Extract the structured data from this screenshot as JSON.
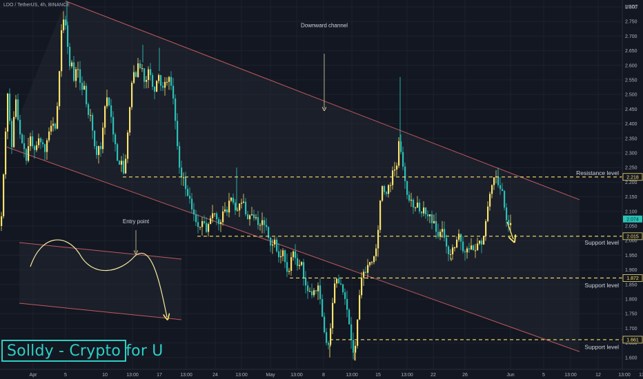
{
  "header": {
    "symbol_line": "LDO / TetherUS, 4h, BINANCE"
  },
  "watermark": {
    "text": "Solldy - Crypto for U"
  },
  "colors": {
    "background": "#131722",
    "up_candle": "#fbe36c",
    "down_candle": "#2ac1b6",
    "channel_line": "#c15a5e",
    "level_line": "#fbe36c",
    "annotation_line": "#e8e2a0"
  },
  "chart_data": {
    "type": "candlestick",
    "title": "",
    "ylabel": "USDT",
    "xlabel": "",
    "ylim": [
      1.58,
      2.83
    ],
    "y_ticks": [
      "1.600",
      "1.650",
      "1.700",
      "1.750",
      "1.800",
      "1.850",
      "1.900",
      "1.950",
      "2.000",
      "2.050",
      "2.100",
      "2.150",
      "2.200",
      "2.250",
      "2.300",
      "2.350",
      "2.400",
      "2.450",
      "2.500",
      "2.550",
      "2.600",
      "2.650",
      "2.700",
      "2.750",
      "2.800"
    ],
    "x_ticks": [
      "Apr",
      "5",
      "10",
      "13:00",
      "17",
      "13:00",
      "24",
      "13:00",
      "May",
      "13:00",
      "8",
      "13:00",
      "15",
      "13:00",
      "22",
      "26",
      "Jun",
      "5",
      "13:00",
      "12",
      "13:00",
      "13"
    ],
    "price_path": [
      [
        0,
        2.06
      ],
      [
        3,
        2.03
      ],
      [
        6,
        2.19
      ],
      [
        9,
        2.3
      ],
      [
        12,
        2.52
      ],
      [
        15,
        2.47
      ],
      [
        18,
        2.29
      ],
      [
        21,
        2.38
      ],
      [
        24,
        2.51
      ],
      [
        27,
        2.43
      ],
      [
        30,
        2.38
      ],
      [
        33,
        2.33
      ],
      [
        36,
        2.34
      ],
      [
        39,
        2.26
      ],
      [
        42,
        2.3
      ],
      [
        45,
        2.37
      ],
      [
        48,
        2.33
      ],
      [
        51,
        2.31
      ],
      [
        54,
        2.31
      ],
      [
        57,
        2.36
      ],
      [
        60,
        2.33
      ],
      [
        63,
        2.35
      ],
      [
        66,
        2.29
      ],
      [
        69,
        2.33
      ],
      [
        72,
        2.37
      ],
      [
        75,
        2.38
      ],
      [
        78,
        2.42
      ],
      [
        81,
        2.36
      ],
      [
        84,
        2.43
      ],
      [
        87,
        2.52
      ],
      [
        90,
        2.7
      ],
      [
        93,
        2.76
      ],
      [
        96,
        2.75
      ],
      [
        99,
        2.71
      ],
      [
        102,
        2.57
      ],
      [
        105,
        2.65
      ],
      [
        108,
        2.53
      ],
      [
        111,
        2.58
      ],
      [
        114,
        2.6
      ],
      [
        117,
        2.56
      ],
      [
        120,
        2.5
      ],
      [
        123,
        2.55
      ],
      [
        126,
        2.49
      ],
      [
        129,
        2.42
      ],
      [
        132,
        2.45
      ],
      [
        135,
        2.39
      ],
      [
        138,
        2.35
      ],
      [
        141,
        2.27
      ],
      [
        144,
        2.34
      ],
      [
        147,
        2.29
      ],
      [
        150,
        2.36
      ],
      [
        153,
        2.44
      ],
      [
        156,
        2.5
      ],
      [
        159,
        2.47
      ],
      [
        162,
        2.45
      ],
      [
        165,
        2.37
      ],
      [
        168,
        2.35
      ],
      [
        171,
        2.29
      ],
      [
        174,
        2.24
      ],
      [
        177,
        2.3
      ],
      [
        180,
        2.22
      ],
      [
        183,
        2.25
      ],
      [
        186,
        2.34
      ],
      [
        189,
        2.43
      ],
      [
        192,
        2.51
      ],
      [
        195,
        2.6
      ],
      [
        198,
        2.53
      ],
      [
        201,
        2.62
      ],
      [
        204,
        2.58
      ],
      [
        207,
        2.61
      ],
      [
        210,
        2.55
      ],
      [
        213,
        2.53
      ],
      [
        216,
        2.59
      ],
      [
        219,
        2.58
      ],
      [
        222,
        2.54
      ],
      [
        225,
        2.5
      ],
      [
        228,
        2.53
      ],
      [
        231,
        2.58
      ],
      [
        234,
        2.54
      ],
      [
        237,
        2.51
      ],
      [
        240,
        2.55
      ],
      [
        243,
        2.53
      ],
      [
        246,
        2.57
      ],
      [
        249,
        2.54
      ],
      [
        252,
        2.51
      ],
      [
        255,
        2.44
      ],
      [
        258,
        2.35
      ],
      [
        261,
        2.27
      ],
      [
        264,
        2.21
      ],
      [
        267,
        2.23
      ],
      [
        270,
        2.19
      ],
      [
        273,
        2.15
      ],
      [
        276,
        2.16
      ],
      [
        279,
        2.11
      ],
      [
        282,
        2.1
      ],
      [
        285,
        2.07
      ],
      [
        288,
        2.05
      ],
      [
        291,
        2.04
      ],
      [
        294,
        2.06
      ],
      [
        297,
        2.08
      ],
      [
        300,
        2.02
      ],
      [
        303,
        2.05
      ],
      [
        306,
        2.07
      ],
      [
        309,
        2.09
      ],
      [
        312,
        2.1
      ],
      [
        315,
        2.08
      ],
      [
        318,
        2.06
      ],
      [
        321,
        2.05
      ],
      [
        324,
        2.09
      ],
      [
        327,
        2.12
      ],
      [
        330,
        2.08
      ],
      [
        333,
        2.13
      ],
      [
        336,
        2.15
      ],
      [
        339,
        2.14
      ],
      [
        342,
        2.11
      ],
      [
        345,
        2.09
      ],
      [
        348,
        2.13
      ],
      [
        351,
        2.12
      ],
      [
        354,
        2.15
      ],
      [
        357,
        2.1
      ],
      [
        360,
        2.07
      ],
      [
        363,
        2.08
      ],
      [
        366,
        2.1
      ],
      [
        369,
        2.07
      ],
      [
        372,
        2.09
      ],
      [
        375,
        2.06
      ],
      [
        378,
        2.04
      ],
      [
        381,
        2.08
      ],
      [
        384,
        2.05
      ],
      [
        387,
        2.06
      ],
      [
        390,
        2.02
      ],
      [
        393,
        1.99
      ],
      [
        396,
        1.97
      ],
      [
        399,
        2.02
      ],
      [
        402,
        1.97
      ],
      [
        405,
        1.95
      ],
      [
        408,
        1.93
      ],
      [
        411,
        1.98
      ],
      [
        414,
        1.94
      ],
      [
        417,
        1.9
      ],
      [
        420,
        1.88
      ],
      [
        423,
        1.93
      ],
      [
        426,
        1.97
      ],
      [
        429,
        1.95
      ],
      [
        432,
        1.92
      ],
      [
        435,
        1.9
      ],
      [
        438,
        1.95
      ],
      [
        441,
        1.88
      ],
      [
        444,
        1.86
      ],
      [
        447,
        1.82
      ],
      [
        450,
        1.84
      ],
      [
        453,
        1.8
      ],
      [
        456,
        1.84
      ],
      [
        459,
        1.81
      ],
      [
        462,
        1.86
      ],
      [
        465,
        1.82
      ],
      [
        468,
        1.76
      ],
      [
        471,
        1.7
      ],
      [
        474,
        1.66
      ],
      [
        477,
        1.63
      ],
      [
        480,
        1.67
      ],
      [
        483,
        1.76
      ],
      [
        486,
        1.84
      ],
      [
        489,
        1.88
      ],
      [
        492,
        1.85
      ],
      [
        495,
        1.86
      ],
      [
        498,
        1.83
      ],
      [
        501,
        1.81
      ],
      [
        504,
        1.78
      ],
      [
        507,
        1.73
      ],
      [
        510,
        1.68
      ],
      [
        513,
        1.62
      ],
      [
        516,
        1.61
      ],
      [
        519,
        1.7
      ],
      [
        522,
        1.79
      ],
      [
        525,
        1.86
      ],
      [
        528,
        1.9
      ],
      [
        531,
        1.88
      ],
      [
        534,
        1.91
      ],
      [
        537,
        1.93
      ],
      [
        540,
        1.92
      ],
      [
        543,
        1.94
      ],
      [
        546,
        1.96
      ],
      [
        549,
        2.0
      ],
      [
        552,
        2.11
      ],
      [
        555,
        2.19
      ],
      [
        558,
        2.18
      ],
      [
        561,
        2.14
      ],
      [
        564,
        2.2
      ],
      [
        567,
        2.17
      ],
      [
        570,
        2.23
      ],
      [
        573,
        2.26
      ],
      [
        576,
        2.21
      ],
      [
        579,
        2.35
      ],
      [
        582,
        2.32
      ],
      [
        585,
        2.27
      ],
      [
        588,
        2.22
      ],
      [
        591,
        2.17
      ],
      [
        594,
        2.13
      ],
      [
        597,
        2.15
      ],
      [
        600,
        2.12
      ],
      [
        603,
        2.1
      ],
      [
        606,
        2.14
      ],
      [
        609,
        2.11
      ],
      [
        612,
        2.08
      ],
      [
        615,
        2.12
      ],
      [
        618,
        2.1
      ],
      [
        621,
        2.07
      ],
      [
        624,
        2.11
      ],
      [
        627,
        2.05
      ],
      [
        630,
        2.08
      ],
      [
        633,
        2.04
      ],
      [
        636,
        2.01
      ],
      [
        639,
        2.02
      ],
      [
        642,
        2.05
      ],
      [
        645,
        2.02
      ],
      [
        648,
        1.99
      ],
      [
        651,
        1.96
      ],
      [
        654,
        1.94
      ],
      [
        657,
        1.98
      ],
      [
        660,
        1.97
      ],
      [
        663,
        1.99
      ],
      [
        666,
        2.03
      ],
      [
        669,
        2.01
      ],
      [
        672,
        1.97
      ],
      [
        675,
        1.95
      ],
      [
        678,
        1.98
      ],
      [
        681,
        1.96
      ],
      [
        684,
        1.99
      ],
      [
        687,
        1.97
      ],
      [
        690,
        1.96
      ],
      [
        693,
        1.98
      ],
      [
        696,
        2.01
      ],
      [
        699,
        1.98
      ],
      [
        702,
        2.0
      ],
      [
        705,
        2.05
      ],
      [
        708,
        2.1
      ],
      [
        711,
        2.15
      ],
      [
        714,
        2.18
      ],
      [
        717,
        2.21
      ],
      [
        720,
        2.23
      ],
      [
        723,
        2.2
      ],
      [
        726,
        2.17
      ],
      [
        729,
        2.19
      ],
      [
        732,
        2.13
      ],
      [
        735,
        2.08
      ],
      [
        738,
        2.05
      ],
      [
        741,
        2.06
      ]
    ],
    "wicks": [
      {
        "x": 97,
        "high": 2.82
      },
      {
        "x": 207,
        "high": 2.67
      },
      {
        "x": 231,
        "high": 2.66
      },
      {
        "x": 343,
        "high": 2.25
      },
      {
        "x": 478,
        "low": 1.6
      },
      {
        "x": 514,
        "low": 1.59
      },
      {
        "x": 580,
        "high": 2.56
      },
      {
        "x": 722,
        "high": 2.25
      },
      {
        "x": 654,
        "low": 1.93
      }
    ],
    "channel": [
      {
        "name": "upper",
        "from": [
          95,
          2.82
        ],
        "to": [
          840,
          2.14
        ]
      },
      {
        "name": "lower",
        "from": [
          10,
          2.32
        ],
        "to": [
          840,
          1.62
        ]
      }
    ],
    "levels": [
      {
        "name": "Resistance level",
        "price": 2.218,
        "badge": "2.218",
        "x_start": 178,
        "label_y": 2.232
      },
      {
        "name": "Support level",
        "price": 2.015,
        "badge": "2.015",
        "x_start": 286,
        "label_y": 1.993
      },
      {
        "name": "Support level",
        "price": 1.872,
        "badge": "1.872",
        "x_start": 420,
        "label_y": 1.847
      },
      {
        "name": "Support level",
        "price": 1.661,
        "badge": "1.661",
        "x_start": 478,
        "label_y": 1.636
      }
    ],
    "current_price": {
      "value": 2.074,
      "badge": "2.074"
    },
    "annotations": [
      {
        "text": "Downward channel",
        "x": 470,
        "y": 2.73
      },
      {
        "text": "Entry point",
        "x": 197,
        "y": 2.06
      }
    ]
  }
}
